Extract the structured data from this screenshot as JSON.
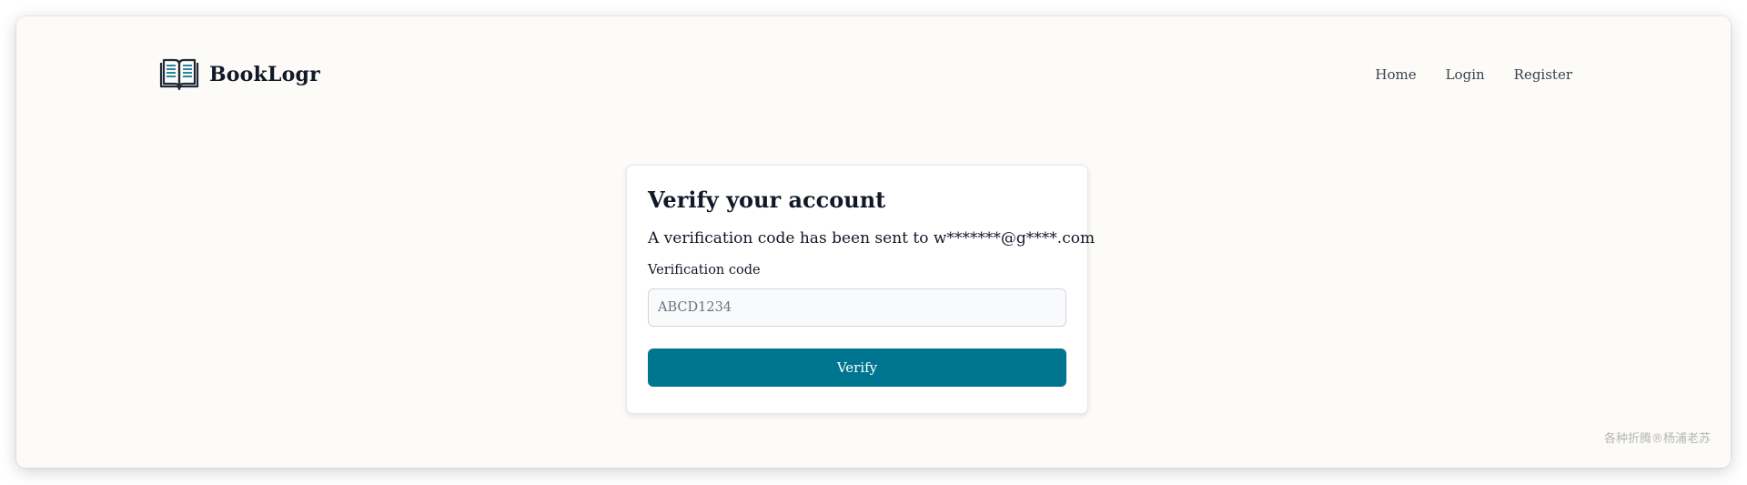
{
  "brand": {
    "name": "BookLogr",
    "logo_icon": "open-book-icon",
    "logo_colors": {
      "outline": "#1f2937",
      "lines": "#0e7490"
    }
  },
  "nav": {
    "items": [
      {
        "label": "Home"
      },
      {
        "label": "Login"
      },
      {
        "label": "Register"
      }
    ]
  },
  "verify": {
    "title": "Verify your account",
    "message": "A verification code has been sent to w*******@g****.com",
    "code_label": "Verification code",
    "code_value": "",
    "code_placeholder": "ABCD1234",
    "submit_label": "Verify"
  },
  "watermark": "各种折腾®杨浦老苏",
  "colors": {
    "page_background": "#fcfbf7",
    "accent": "#00758f",
    "text": "#111827"
  }
}
